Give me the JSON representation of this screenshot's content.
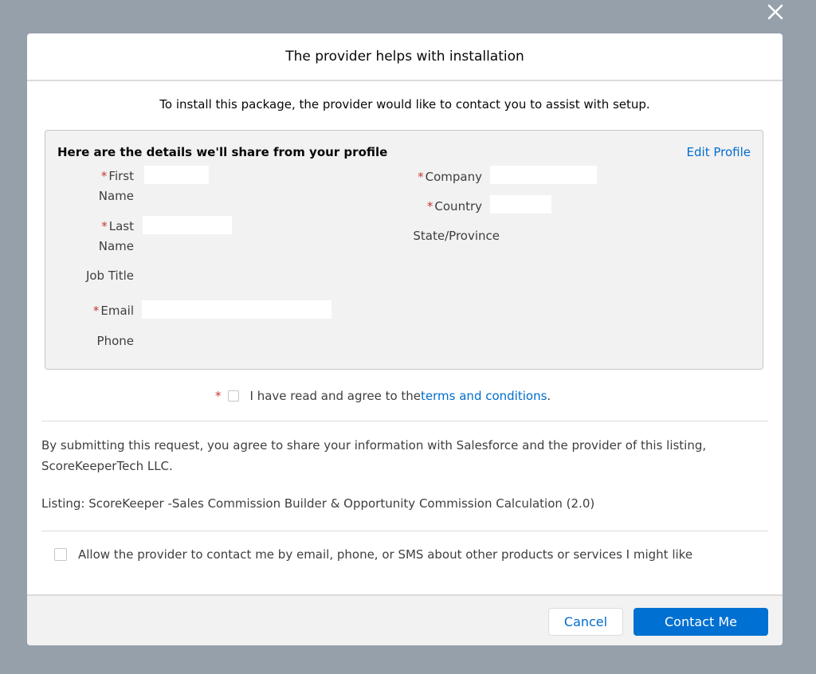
{
  "modal": {
    "title": "The provider helps with installation",
    "intro": "To install this package, the provider would like to contact you to assist with setup."
  },
  "profile": {
    "heading": "Here are the details we'll share from your profile",
    "edit_label": "Edit Profile",
    "required_marker": "*",
    "fields": {
      "first_name": {
        "line1": "First",
        "line2": "Name",
        "value": ""
      },
      "last_name": {
        "line1": "Last",
        "line2": "Name",
        "value": ""
      },
      "job_title": {
        "label": "Job Title"
      },
      "email": {
        "label": "Email",
        "value": ""
      },
      "phone": {
        "label": "Phone"
      },
      "company": {
        "label": "Company",
        "value": ""
      },
      "country": {
        "label": "Country",
        "value": ""
      },
      "state": {
        "label": "State/Province"
      }
    }
  },
  "agreement": {
    "text": "I have read and agree to the ",
    "link": "terms and conditions",
    "suffix": "."
  },
  "disclaimer": "By submitting this request, you agree to share your information with Salesforce and the provider of this listing, ScoreKeeperTech LLC.",
  "listing": "Listing: ScoreKeeper -Sales Commission Builder & Opportunity Commission Calculation (2.0)",
  "consent": "Allow the provider to contact me by email, phone, or SMS about other products or services I might like",
  "footer": {
    "cancel_label": "Cancel",
    "contact_label": "Contact Me"
  },
  "icons": {
    "close": "close-icon"
  },
  "colors": {
    "accent": "#0070d2",
    "link": "#006dcc",
    "required": "#c23934",
    "overlay": "#95a0ab"
  }
}
